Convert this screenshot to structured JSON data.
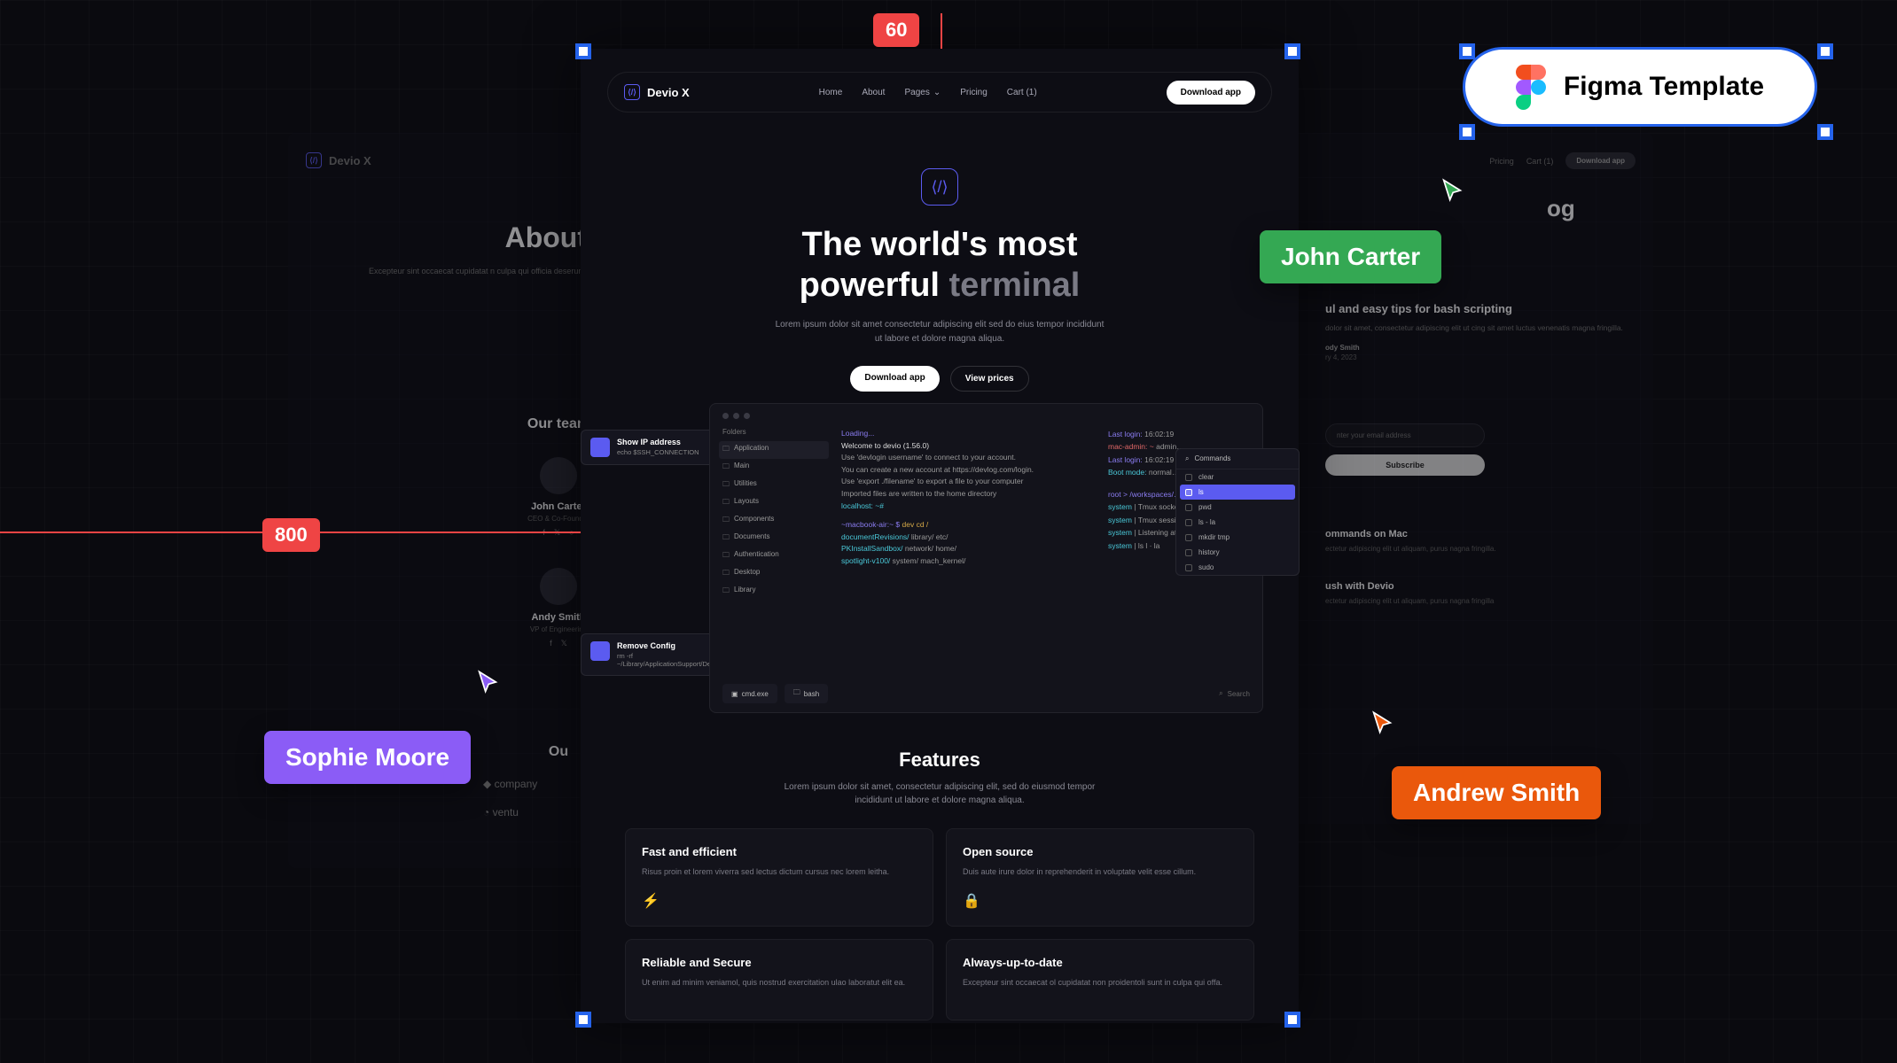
{
  "figma_chip": "Figma Template",
  "measurements": {
    "top": "60",
    "left": "800"
  },
  "collaborators": {
    "john": "John Carter",
    "sophie": "Sophie Moore",
    "andrew": "Andrew Smith"
  },
  "brand": "Devio X",
  "nav": {
    "links": [
      "Home",
      "About",
      "Pages",
      "Pricing",
      "Cart (1)"
    ],
    "cta": "Download app"
  },
  "hero": {
    "title_line1": "The world's most",
    "title_line2a": "powerful ",
    "title_line2b": "terminal",
    "subtitle": "Lorem ipsum dolor sit amet consectetur adipiscing elit sed do eius tempor incididunt ut labore et dolore magna aliqua.",
    "btn_primary": "Download app",
    "btn_secondary": "View prices"
  },
  "terminal": {
    "tooltip1_title": "Show IP address",
    "tooltip1_body": "echo $SSH_CONNECTION",
    "tooltip2_title": "Remove Config",
    "tooltip2_body": "rm -rf ~/Library/ApplicationSupport/Devio",
    "folders_label": "Folders",
    "folders": [
      "Application",
      "Main",
      "Utilities",
      "Layouts",
      "Components",
      "Documents",
      "Authentication",
      "Desktop",
      "Library"
    ],
    "log_loading": "Loading...",
    "log_welcome": "Welcome to devio (1.56.0)",
    "log_lines": [
      "Use 'devlogin username' to connect to your account.",
      "You can create a new account at https://devlog.com/login.",
      "Use 'export ./filename' to export a file to your computer",
      "Imported files are written to the home directory"
    ],
    "log_localhost": "localhost: ~#",
    "log_mac_prompt": "~macbook-air:~ $",
    "log_mac_cmd": " dev cd /",
    "log_paths": [
      {
        "a": "documentRevisions/",
        "b": "  library/   etc/"
      },
      {
        "a": "PKInstallSandbox/",
        "b": "  network/   home/"
      },
      {
        "a": "spotlight-v100/",
        "b": "  system/   mach_kernel/"
      }
    ],
    "right_last_login": "Last login: ",
    "right_time": "16:02:19",
    "right_mac": "mac-admin: ~ ",
    "right_admin": "admin…",
    "right_boot": "Boot mode: ",
    "right_normal": "normal…",
    "right_root": "root > /workspaces/…",
    "right_sys": "system",
    "right_tmux1": " | Tmux socket: Tmux…",
    "right_tmux2": " | Tmux session ID:",
    "right_listen": " | Listening at /tmp/…",
    "right_ls": " | ls  l · la",
    "cmd_header": "Commands",
    "cmds": [
      "clear",
      "ls",
      "pwd",
      "ls - la",
      "mkdir tmp",
      "history",
      "sudo"
    ],
    "tab1": "cmd.exe",
    "tab2": "bash",
    "search": "Search"
  },
  "features": {
    "heading": "Features",
    "subtitle": "Lorem ipsum dolor sit amet, consectetur adipiscing elit, sed do eiusmod tempor incididunt ut labore et dolore magna aliqua.",
    "cards": [
      {
        "title": "Fast and efficient",
        "body": "Risus proin et lorem viverra sed lectus dictum cursus nec lorem leitha."
      },
      {
        "title": "Open source",
        "body": "Duis aute irure dolor in reprehenderit in voluptate velit esse cillum."
      },
      {
        "title": "Reliable and Secure",
        "body": "Ut enim ad minim veniamol, quis nostrud exercitation ulao laboratut elit ea."
      },
      {
        "title": "Always-up-to-date",
        "body": "Excepteur sint occaecat ol cupidatat non proidentoli sunt in culpa qui offa."
      }
    ]
  },
  "left_frame": {
    "about_title_prefix": "About o",
    "about_body": "Excepteur sint occaecat cupidatat n culpa qui officia deserunt mollit est labore et dolore magna aliqua enim.",
    "team_heading": "Our team",
    "members": [
      {
        "name": "John Carter",
        "role": "CEO & Co-Founder"
      },
      {
        "name": "Andy Smith",
        "role": "VP of Engineering"
      }
    ],
    "investors_heading_prefix": "Ou",
    "investors": [
      "company",
      "ventu"
    ]
  },
  "right_frame": {
    "big_title_suffix": "og",
    "post1_title": "ul and easy tips for bash scripting",
    "post1_body": "dolor sit amet, consectetur adipiscing elit ut cing sit amet luctus venenatis magna fringilla.",
    "post1_author": "ody Smith",
    "post1_date": "ry 4, 2023",
    "email_placeholder": "nter your email address",
    "subscribe": "Subscribe",
    "list": [
      {
        "title": "ommands on Mac",
        "body": "ectetur adipiscing elit ut aliquam, purus nagna fringilla."
      },
      {
        "title": "ush with Devio",
        "body": "ectetur adipiscing elit ut aliquam, purus nagna fringilla"
      }
    ]
  }
}
